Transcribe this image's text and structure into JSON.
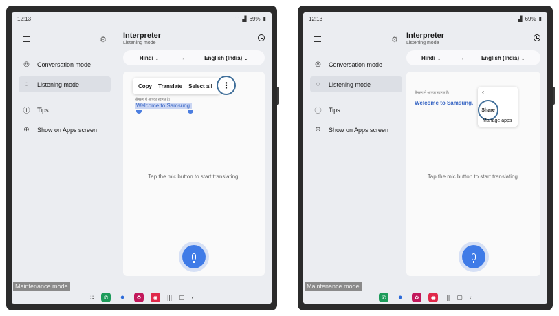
{
  "status": {
    "time": "12:13",
    "battery": "69%"
  },
  "sidebar": {
    "items": [
      {
        "label": "Conversation mode",
        "icon": "conversation-icon"
      },
      {
        "label": "Listening mode",
        "icon": "listening-icon"
      },
      {
        "label": "Tips",
        "icon": "info-icon"
      },
      {
        "label": "Show on Apps screen",
        "icon": "add-icon"
      }
    ]
  },
  "header": {
    "title": "Interpreter",
    "subtitle": "Listening mode"
  },
  "languages": {
    "source": "Hindi",
    "target": "English (India)"
  },
  "hint": "Tap the mic button to start translating.",
  "context_menu": {
    "copy": "Copy",
    "translate": "Translate",
    "select_all": "Select all"
  },
  "content": {
    "source_text": "सैमसंग में आपका स्वागत है।",
    "translated_text": "Welcome to Samsung."
  },
  "popup": {
    "share": "Share",
    "manage": "Manage apps"
  },
  "overlay": {
    "maintenance": "Maintenance mode"
  },
  "colors": {
    "accent": "#3f7be7",
    "highlight": "#3f6e99",
    "phone": "#1d9b5a"
  }
}
